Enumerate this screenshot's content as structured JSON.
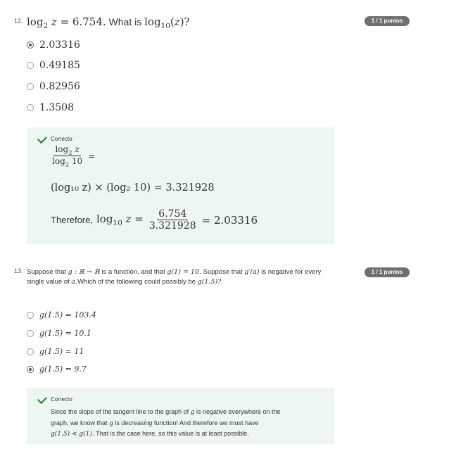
{
  "q1": {
    "number": "12.",
    "title_math": "log₂ z = 6.754.",
    "title_tail": "What is",
    "title_math2": "log₁₀(z)?",
    "badge": "1 / 1 puntos",
    "options": [
      "2.03316",
      "0.49185",
      "0.82956",
      "1.3508"
    ],
    "selected_index": 0,
    "feedback": {
      "label": "Correcto",
      "eq2": "(log₁₀ z) × (log₂ 10) = 3.321928",
      "therefore": "Therefore,",
      "frac_num": "6.754",
      "frac_den": "3.321928",
      "result": "= 2.03316"
    }
  },
  "q2": {
    "number": "13.",
    "text_a": "Suppose that",
    "text_b": "g : ℝ → ℝ",
    "text_c": "is a function, and that",
    "text_d": "g(1) = 10.",
    "text_e": "Suppose that",
    "text_f": "g′(a)",
    "text_g": "is negative for every single value of",
    "text_h": "a.",
    "text_i": "Which of the following could possibly be",
    "text_j": "g(1.5)?",
    "badge": "1 / 1 puntos",
    "options": [
      "g(1.5) = 103.4",
      "g(1.5) = 10.1",
      "g(1.5) = 11",
      "g(1.5) = 9.7"
    ],
    "selected_index": 3,
    "feedback": {
      "label": "Correcto",
      "line1a": "Since the slope of the tangent line to the graph of",
      "line1b": "g",
      "line1c": "is negative everywhere on the",
      "line2a": "graph, we know that",
      "line2b": "g",
      "line2c": "is",
      "line2d": "decreasing",
      "line2e": "function! And therefore we must have",
      "line3a": "g(1.5) < g(1).",
      "line3b": "That is the case here, so this value is at least possible."
    }
  }
}
